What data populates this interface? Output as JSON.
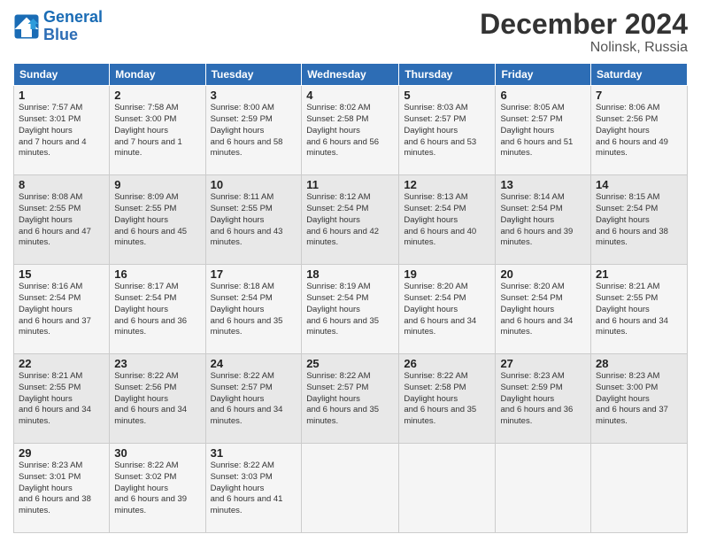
{
  "logo": {
    "line1": "General",
    "line2": "Blue"
  },
  "title": "December 2024",
  "subtitle": "Nolinsk, Russia",
  "headers": [
    "Sunday",
    "Monday",
    "Tuesday",
    "Wednesday",
    "Thursday",
    "Friday",
    "Saturday"
  ],
  "weeks": [
    [
      {
        "day": "1",
        "sunrise": "7:57 AM",
        "sunset": "3:01 PM",
        "daylight": "7 hours and 4 minutes."
      },
      {
        "day": "2",
        "sunrise": "7:58 AM",
        "sunset": "3:00 PM",
        "daylight": "7 hours and 1 minute."
      },
      {
        "day": "3",
        "sunrise": "8:00 AM",
        "sunset": "2:59 PM",
        "daylight": "6 hours and 58 minutes."
      },
      {
        "day": "4",
        "sunrise": "8:02 AM",
        "sunset": "2:58 PM",
        "daylight": "6 hours and 56 minutes."
      },
      {
        "day": "5",
        "sunrise": "8:03 AM",
        "sunset": "2:57 PM",
        "daylight": "6 hours and 53 minutes."
      },
      {
        "day": "6",
        "sunrise": "8:05 AM",
        "sunset": "2:57 PM",
        "daylight": "6 hours and 51 minutes."
      },
      {
        "day": "7",
        "sunrise": "8:06 AM",
        "sunset": "2:56 PM",
        "daylight": "6 hours and 49 minutes."
      }
    ],
    [
      {
        "day": "8",
        "sunrise": "8:08 AM",
        "sunset": "2:55 PM",
        "daylight": "6 hours and 47 minutes."
      },
      {
        "day": "9",
        "sunrise": "8:09 AM",
        "sunset": "2:55 PM",
        "daylight": "6 hours and 45 minutes."
      },
      {
        "day": "10",
        "sunrise": "8:11 AM",
        "sunset": "2:55 PM",
        "daylight": "6 hours and 43 minutes."
      },
      {
        "day": "11",
        "sunrise": "8:12 AM",
        "sunset": "2:54 PM",
        "daylight": "6 hours and 42 minutes."
      },
      {
        "day": "12",
        "sunrise": "8:13 AM",
        "sunset": "2:54 PM",
        "daylight": "6 hours and 40 minutes."
      },
      {
        "day": "13",
        "sunrise": "8:14 AM",
        "sunset": "2:54 PM",
        "daylight": "6 hours and 39 minutes."
      },
      {
        "day": "14",
        "sunrise": "8:15 AM",
        "sunset": "2:54 PM",
        "daylight": "6 hours and 38 minutes."
      }
    ],
    [
      {
        "day": "15",
        "sunrise": "8:16 AM",
        "sunset": "2:54 PM",
        "daylight": "6 hours and 37 minutes."
      },
      {
        "day": "16",
        "sunrise": "8:17 AM",
        "sunset": "2:54 PM",
        "daylight": "6 hours and 36 minutes."
      },
      {
        "day": "17",
        "sunrise": "8:18 AM",
        "sunset": "2:54 PM",
        "daylight": "6 hours and 35 minutes."
      },
      {
        "day": "18",
        "sunrise": "8:19 AM",
        "sunset": "2:54 PM",
        "daylight": "6 hours and 35 minutes."
      },
      {
        "day": "19",
        "sunrise": "8:20 AM",
        "sunset": "2:54 PM",
        "daylight": "6 hours and 34 minutes."
      },
      {
        "day": "20",
        "sunrise": "8:20 AM",
        "sunset": "2:54 PM",
        "daylight": "6 hours and 34 minutes."
      },
      {
        "day": "21",
        "sunrise": "8:21 AM",
        "sunset": "2:55 PM",
        "daylight": "6 hours and 34 minutes."
      }
    ],
    [
      {
        "day": "22",
        "sunrise": "8:21 AM",
        "sunset": "2:55 PM",
        "daylight": "6 hours and 34 minutes."
      },
      {
        "day": "23",
        "sunrise": "8:22 AM",
        "sunset": "2:56 PM",
        "daylight": "6 hours and 34 minutes."
      },
      {
        "day": "24",
        "sunrise": "8:22 AM",
        "sunset": "2:57 PM",
        "daylight": "6 hours and 34 minutes."
      },
      {
        "day": "25",
        "sunrise": "8:22 AM",
        "sunset": "2:57 PM",
        "daylight": "6 hours and 35 minutes."
      },
      {
        "day": "26",
        "sunrise": "8:22 AM",
        "sunset": "2:58 PM",
        "daylight": "6 hours and 35 minutes."
      },
      {
        "day": "27",
        "sunrise": "8:23 AM",
        "sunset": "2:59 PM",
        "daylight": "6 hours and 36 minutes."
      },
      {
        "day": "28",
        "sunrise": "8:23 AM",
        "sunset": "3:00 PM",
        "daylight": "6 hours and 37 minutes."
      }
    ],
    [
      {
        "day": "29",
        "sunrise": "8:23 AM",
        "sunset": "3:01 PM",
        "daylight": "6 hours and 38 minutes."
      },
      {
        "day": "30",
        "sunrise": "8:22 AM",
        "sunset": "3:02 PM",
        "daylight": "6 hours and 39 minutes."
      },
      {
        "day": "31",
        "sunrise": "8:22 AM",
        "sunset": "3:03 PM",
        "daylight": "6 hours and 41 minutes."
      },
      null,
      null,
      null,
      null
    ]
  ]
}
